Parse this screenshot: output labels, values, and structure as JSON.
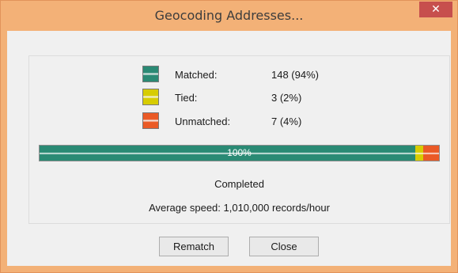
{
  "window": {
    "title": "Geocoding Addresses...",
    "close_glyph": "✕"
  },
  "legend": [
    {
      "label": "Matched:",
      "value": "148 (94%)",
      "color": "#2a8a74"
    },
    {
      "label": "Tied:",
      "value": "3 (2%)",
      "color": "#d7cc00"
    },
    {
      "label": "Unmatched:",
      "value": "7 (4%)",
      "color": "#ea5a26"
    }
  ],
  "progress": {
    "text": "100%",
    "matched_fraction": 0.94,
    "tied_fraction": 0.02,
    "unmatched_fraction": 0.04
  },
  "status": {
    "completed": "Completed",
    "speed": "Average speed: 1,010,000 records/hour"
  },
  "buttons": {
    "rematch": "Rematch",
    "close": "Close"
  }
}
